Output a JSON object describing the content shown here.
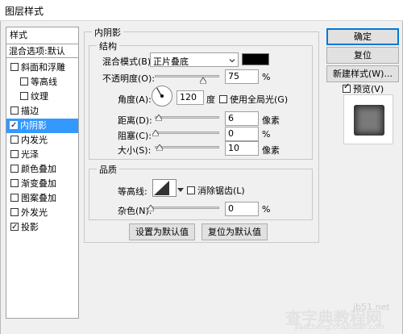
{
  "window": {
    "title": "图层样式"
  },
  "styles_panel": {
    "header": "样式",
    "blend_options": "混合选项:默认",
    "items": [
      {
        "label": "斜面和浮雕",
        "checked": false
      },
      {
        "label": "等高线",
        "checked": false
      },
      {
        "label": "纹理",
        "checked": false
      },
      {
        "label": "描边",
        "checked": false
      },
      {
        "label": "内阴影",
        "checked": true,
        "selected": true
      },
      {
        "label": "内发光",
        "checked": false
      },
      {
        "label": "光泽",
        "checked": false
      },
      {
        "label": "颜色叠加",
        "checked": false
      },
      {
        "label": "渐变叠加",
        "checked": false
      },
      {
        "label": "图案叠加",
        "checked": false
      },
      {
        "label": "外发光",
        "checked": false
      },
      {
        "label": "投影",
        "checked": true
      }
    ]
  },
  "inner_shadow": {
    "title": "内阴影",
    "structure": {
      "title": "结构",
      "blend_mode_label": "混合模式(B):",
      "blend_mode_value": "正片叠底",
      "shadow_color": "#000000",
      "opacity_label": "不透明度(O):",
      "opacity_value": "75",
      "opacity_unit": "%",
      "opacity_fraction": 0.75,
      "angle_label": "角度(A):",
      "angle_value": "120",
      "angle_unit": "度",
      "global_light_label": "使用全局光(G)",
      "global_light_checked": false,
      "distance_label": "距离(D):",
      "distance_value": "6",
      "distance_unit": "像素",
      "choke_label": "阻塞(C):",
      "choke_value": "0",
      "choke_unit": "%",
      "size_label": "大小(S):",
      "size_value": "10",
      "size_unit": "像素"
    },
    "quality": {
      "title": "品质",
      "contour_label": "等高线:",
      "anti_alias_label": "消除锯齿(L)",
      "anti_alias_checked": false,
      "noise_label": "杂色(N):",
      "noise_value": "0",
      "noise_unit": "%"
    },
    "make_default": "设置为默认值",
    "reset_default": "复位为默认值"
  },
  "right_panel": {
    "ok": "确定",
    "reset": "复位",
    "new_style": "新建样式(W)...",
    "preview_label": "预览(V)",
    "preview_checked": true
  },
  "watermark": {
    "line1": "查字典",
    "line2": "教程网",
    "site": "jb51.net",
    "url": "jiaocheng.chazidian.com"
  },
  "colors": {
    "selection": "#3399ff",
    "primary_button_border": "#0078d7",
    "dialog_bg": "#f0f0f0"
  }
}
